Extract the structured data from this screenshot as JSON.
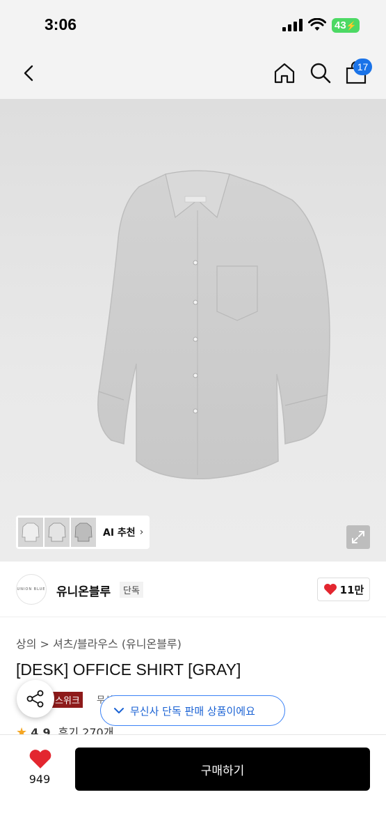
{
  "status": {
    "time": "3:06",
    "battery": "43"
  },
  "nav": {
    "cart_count": "17"
  },
  "hero": {
    "ai_label": "AI 추천"
  },
  "brand": {
    "logo_text": "UNION BLUE",
    "name": "유니온블루",
    "exclusive": "단독",
    "likes": "11만"
  },
  "product": {
    "breadcrumb": "상의 > 셔츠/블라우스 (유니온블루)",
    "title": "[DESK] OFFICE SHIRT [GRAY]",
    "tag_red": "스위크",
    "tag_gray": "무신사",
    "rating": "4.9",
    "reviews": "후기 270개"
  },
  "toast": {
    "text": "무신사 단독 판매 상품이에요"
  },
  "bottom": {
    "like_count": "949",
    "buy_label": "구매하기"
  },
  "colors": {
    "accent_blue": "#1a73e8",
    "like_red": "#e3262f",
    "tag_red": "#8e1a1a",
    "buy_black": "#000000"
  }
}
